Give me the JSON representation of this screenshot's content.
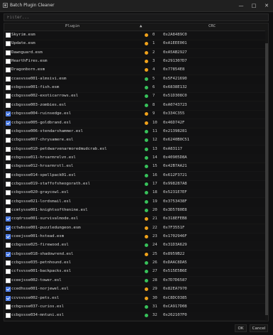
{
  "window": {
    "title": "Batch Plugin Cleaner",
    "minimize_label": "—",
    "maximize_label": "□",
    "close_label": "✕"
  },
  "filter": {
    "placeholder": "Filter..."
  },
  "table": {
    "headers": {
      "plugin": "Plugin",
      "crc": "CRC"
    },
    "rows": [
      {
        "name": "Skyrim.esm",
        "checked": false,
        "status_color": "#f0a21a",
        "index": "0",
        "crc": "0x2A8489C0"
      },
      {
        "name": "Update.esm",
        "checked": false,
        "status_color": "#f0a21a",
        "index": "1",
        "crc": "0xA1EEE001"
      },
      {
        "name": "Dawnguard.esm",
        "checked": false,
        "status_color": "#f0a21a",
        "index": "2",
        "crc": "0xA5AB2927"
      },
      {
        "name": "HearthFires.esm",
        "checked": false,
        "status_color": "#f0a21a",
        "index": "3",
        "crc": "0x291307D7"
      },
      {
        "name": "Dragonborn.esm",
        "checked": false,
        "status_color": "#f0a21a",
        "index": "4",
        "crc": "0x77854E8"
      },
      {
        "name": "ccasvsse001-almsivi.esm",
        "checked": false,
        "status_color": "#37c15a",
        "index": "5",
        "crc": "0x5F421690"
      },
      {
        "name": "ccbgssse001-fish.esm",
        "checked": false,
        "status_color": "#37c15a",
        "index": "6",
        "crc": "0x6838E132"
      },
      {
        "name": "ccbgssse002-exoticarrows.esl",
        "checked": false,
        "status_color": "#37c15a",
        "index": "7",
        "crc": "0x51D308C0"
      },
      {
        "name": "ccbgssse003-zombies.esl",
        "checked": false,
        "status_color": "#37c15a",
        "index": "8",
        "crc": "0xA0743723"
      },
      {
        "name": "ccbgssse004-ruinsedge.esl",
        "checked": true,
        "status_color": "#f0a21a",
        "index": "9",
        "crc": "0x334C355"
      },
      {
        "name": "ccbgssse005-goldbrand.esl",
        "checked": true,
        "status_color": "#f0a21a",
        "index": "10",
        "crc": "0x46D742F"
      },
      {
        "name": "ccbgssse006-stendarshammer.esl",
        "checked": false,
        "status_color": "#37c15a",
        "index": "11",
        "crc": "0x21398281"
      },
      {
        "name": "ccbgssse007-chrysamere.esl",
        "checked": false,
        "status_color": "#37c15a",
        "index": "12",
        "crc": "0x6240B0C51"
      },
      {
        "name": "ccbgssse010-petdwarvenarmoredmudcrab.esl",
        "checked": false,
        "status_color": "#37c15a",
        "index": "13",
        "crc": "0xA83117"
      },
      {
        "name": "ccbgssse011-hrsarmrelvn.esl",
        "checked": false,
        "status_color": "#37c15a",
        "index": "14",
        "crc": "0x40905D8A"
      },
      {
        "name": "ccbgssse012-hrsarmrstl.esl",
        "checked": false,
        "status_color": "#37c15a",
        "index": "15",
        "crc": "0x42B7AA21"
      },
      {
        "name": "ccbgssse014-spellpack01.esl",
        "checked": false,
        "status_color": "#37c15a",
        "index": "16",
        "crc": "0x612F3721"
      },
      {
        "name": "ccbgssse019-staffofsheogorath.esl",
        "checked": false,
        "status_color": "#37c15a",
        "index": "17",
        "crc": "0x998287A8"
      },
      {
        "name": "ccbgssse020-graycowl.esl",
        "checked": false,
        "status_color": "#37c15a",
        "index": "18",
        "crc": "0x5231E7EF"
      },
      {
        "name": "ccbgssse021-lordsmail.esl",
        "checked": false,
        "status_color": "#37c15a",
        "index": "19",
        "crc": "0x3753438F"
      },
      {
        "name": "ccmtysse001-knightsofthenine.esl",
        "checked": false,
        "status_color": "#37c15a",
        "index": "20",
        "crc": "0x3D5780E8"
      },
      {
        "name": "ccqdrsse001-survivalmode.esl",
        "checked": true,
        "status_color": "#f0a21a",
        "index": "21",
        "crc": "0x318EFEB8"
      },
      {
        "name": "cctwbsse001-puzzledungeon.esm",
        "checked": true,
        "status_color": "#f0a21a",
        "index": "22",
        "crc": "0x7F3551F"
      },
      {
        "name": "cceejsse001-hstead.esm",
        "checked": true,
        "status_color": "#f0a21a",
        "index": "23",
        "crc": "0x1702946F"
      },
      {
        "name": "ccbgssse025-firewood.esl",
        "checked": false,
        "status_color": "#37c15a",
        "index": "24",
        "crc": "0x31D3A629"
      },
      {
        "name": "ccbgssse018-shadowrend.esl",
        "checked": true,
        "status_color": "#f0a21a",
        "index": "25",
        "crc": "0x8959B22"
      },
      {
        "name": "ccbgssse035-petnhound.esl",
        "checked": false,
        "status_color": "#37c15a",
        "index": "26",
        "crc": "0xDAAC8DA5"
      },
      {
        "name": "ccfsvsse001-backpacks.esl",
        "checked": false,
        "status_color": "#37c15a",
        "index": "27",
        "crc": "0x515E5B6E"
      },
      {
        "name": "cceejsse002-tower.esl",
        "checked": false,
        "status_color": "#37c15a",
        "index": "28",
        "crc": "0x7D7D6587"
      },
      {
        "name": "ccedhsse001-norjewel.esl",
        "checked": true,
        "status_color": "#f0a21a",
        "index": "29",
        "crc": "0x82EA7970"
      },
      {
        "name": "ccvsvsse002-pets.esl",
        "checked": true,
        "status_color": "#f0a21a",
        "index": "30",
        "crc": "0xC8DC0385"
      },
      {
        "name": "ccbgssse037-curios.esl",
        "checked": false,
        "status_color": "#37c15a",
        "index": "31",
        "crc": "0xCA917D08"
      },
      {
        "name": "ccbgssse034-mntuni.esl",
        "checked": false,
        "status_color": "#37c15a",
        "index": "32",
        "crc": "0x262107F0"
      }
    ]
  },
  "footer": {
    "ok_label": "OK",
    "cancel_label": "Cancel"
  }
}
